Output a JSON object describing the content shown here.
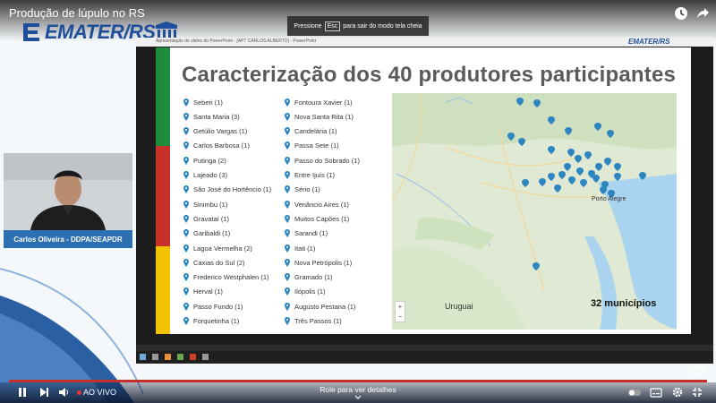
{
  "video": {
    "title": "Produção de lúpulo no RS",
    "esc_before": "Pressione",
    "esc_key": "Esc",
    "esc_after": "para sair do modo tela cheia",
    "logo": "EMATER/RS"
  },
  "presenter": {
    "name": "Carlos Oliveira - DDPA/SEAPDR"
  },
  "share": {
    "titlebar": "Apresentação de slides do PowerPoint - [APT CARLOS ALBERTO] - PowerPoint",
    "logo": "EMATER/RS"
  },
  "slide": {
    "title": "Caracterização dos 40 produtores participantes",
    "column1": [
      "Seberi (1)",
      "Santa Maria (3)",
      "Getúlio Vargas (1)",
      "Carlos Barbosa (1)",
      "Putinga (2)",
      "Lajeado (3)",
      "São José do Hortêncio (1)",
      "Sinimbu (1)",
      "Gravataí (1)",
      "Garibaldi (1)",
      "Lagoa Vermelha (2)",
      "Caxias do Sul (2)",
      "Frederico Westphalen (1)",
      "Herval (1)",
      "Passo Fundo (1)",
      "Forquetinha (1)"
    ],
    "column2": [
      "Fontoura Xavier (1)",
      "Nova Santa Rita (1)",
      "Candelária (1)",
      "Passa Sete (1)",
      "Passo do Sobrado (1)",
      "Entre Ijuís (1)",
      "Sério (1)",
      "Venâncio Aires (1)",
      "Muitos Capões (1)",
      "Sarandi (1)",
      "Itati (1)",
      "Nova Petrópolis (1)",
      "Gramado (1)",
      "Ilópolis (1)",
      "Augusto Pestana (1)",
      "Três Passos (1)"
    ],
    "map": {
      "count_label": "32 municípios",
      "country_label": "Uruguai",
      "city_label": "Porto Alegre",
      "zoom_in": "+",
      "zoom_out": "−"
    }
  },
  "player": {
    "live_label": "AO VIVO",
    "scroll_hint": "Role para ver detalhes"
  },
  "colors": {
    "accent_blue": "#1f4f9a",
    "stripe_green": "#1e8c3a",
    "stripe_red": "#c9302c",
    "stripe_yellow": "#f2c200",
    "pin": "#2e86c1",
    "live_red": "#e53935"
  }
}
